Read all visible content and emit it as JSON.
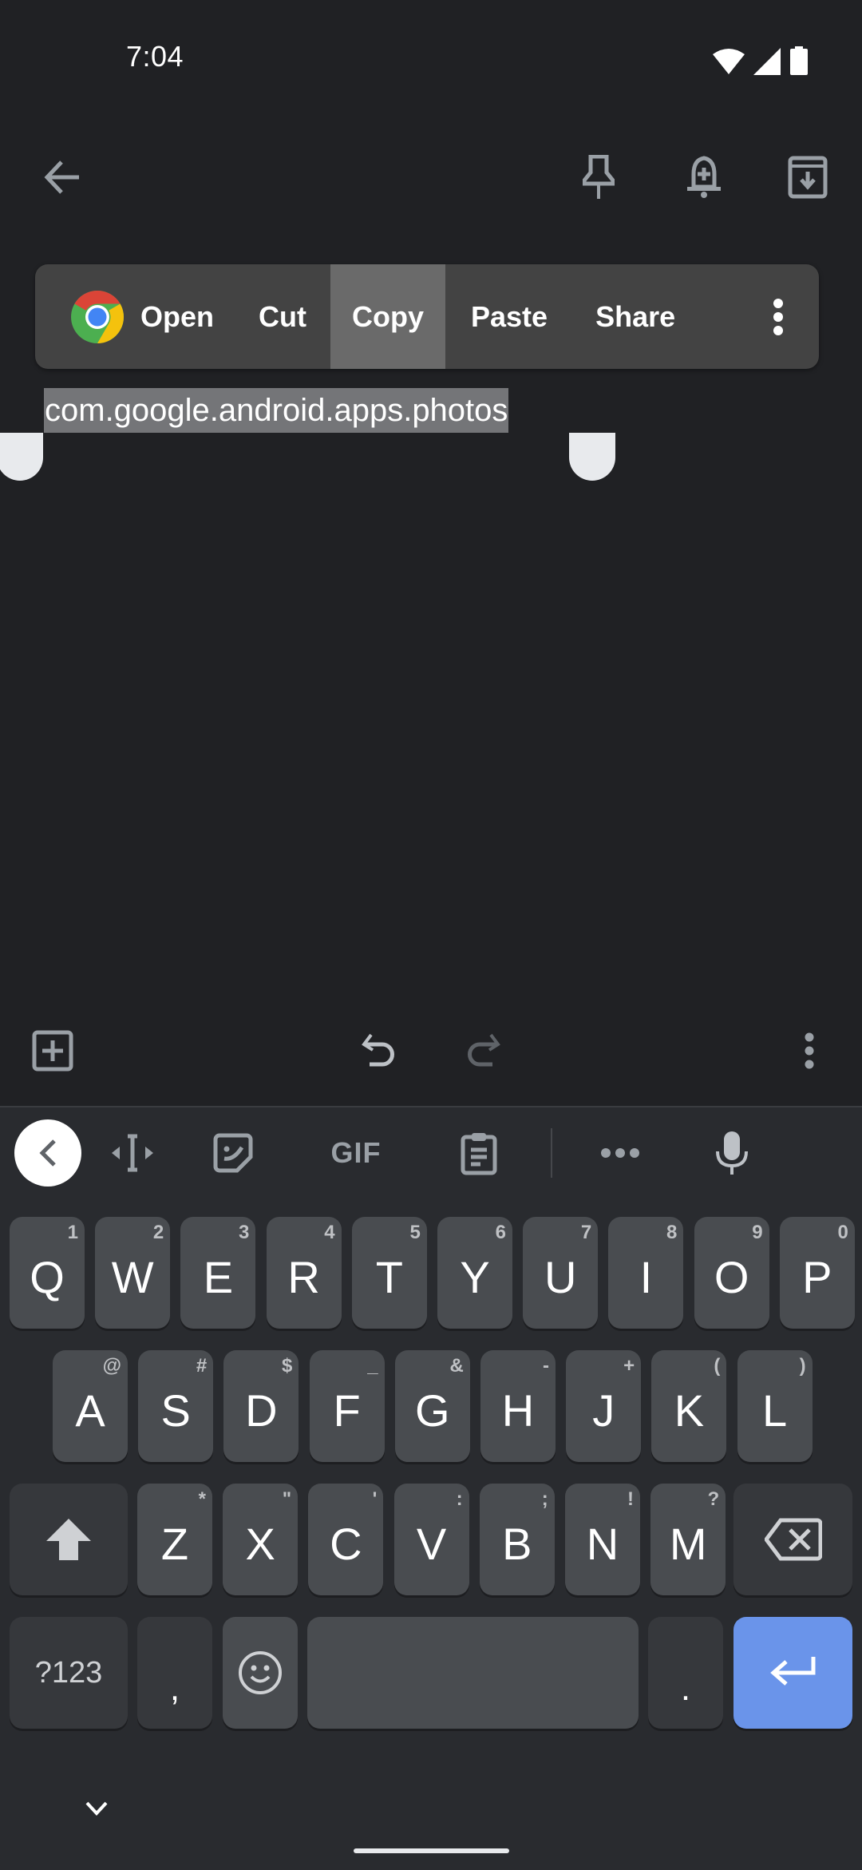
{
  "status_bar": {
    "time": "7:04",
    "icons": [
      "wifi-icon",
      "cell-signal-icon",
      "battery-icon"
    ]
  },
  "top_toolbar": {
    "back": "back-arrow-icon",
    "actions": [
      "pin-icon",
      "reminder-bell-icon",
      "archive-icon"
    ]
  },
  "selection_menu": {
    "items": [
      {
        "label": "Open",
        "icon": "chrome-icon",
        "active": false
      },
      {
        "label": "Cut",
        "active": false
      },
      {
        "label": "Copy",
        "active": true
      },
      {
        "label": "Paste",
        "active": false
      },
      {
        "label": "Share",
        "active": false
      }
    ],
    "more": "more-vert-icon"
  },
  "note": {
    "selected_text": "com.google.android.apps.photos"
  },
  "note_toolbar": {
    "add": "add-box-icon",
    "undo": "undo-icon",
    "redo": "redo-icon",
    "more": "more-vert-icon"
  },
  "keyboard": {
    "toolbar": [
      "collapse-chevron-icon",
      "text-cursor-icon",
      "sticker-icon",
      "GIF",
      "clipboard-icon",
      "more-horiz-icon",
      "mic-icon"
    ],
    "gif_label": "GIF",
    "row1": [
      {
        "k": "Q",
        "h": "1"
      },
      {
        "k": "W",
        "h": "2"
      },
      {
        "k": "E",
        "h": "3"
      },
      {
        "k": "R",
        "h": "4"
      },
      {
        "k": "T",
        "h": "5"
      },
      {
        "k": "Y",
        "h": "6"
      },
      {
        "k": "U",
        "h": "7"
      },
      {
        "k": "I",
        "h": "8"
      },
      {
        "k": "O",
        "h": "9"
      },
      {
        "k": "P",
        "h": "0"
      }
    ],
    "row2": [
      {
        "k": "A",
        "h": "@"
      },
      {
        "k": "S",
        "h": "#"
      },
      {
        "k": "D",
        "h": "$"
      },
      {
        "k": "F",
        "h": "_"
      },
      {
        "k": "G",
        "h": "&"
      },
      {
        "k": "H",
        "h": "-"
      },
      {
        "k": "J",
        "h": "+"
      },
      {
        "k": "K",
        "h": "("
      },
      {
        "k": "L",
        "h": ")"
      }
    ],
    "row3": [
      {
        "k": "Z",
        "h": "*"
      },
      {
        "k": "X",
        "h": "\""
      },
      {
        "k": "C",
        "h": "'"
      },
      {
        "k": "V",
        "h": ":"
      },
      {
        "k": "B",
        "h": ";"
      },
      {
        "k": "N",
        "h": "!"
      },
      {
        "k": "M",
        "h": "?"
      }
    ],
    "symbols_label": "?123",
    "comma": ",",
    "period": ".",
    "accent_color": "#6a94ea"
  }
}
